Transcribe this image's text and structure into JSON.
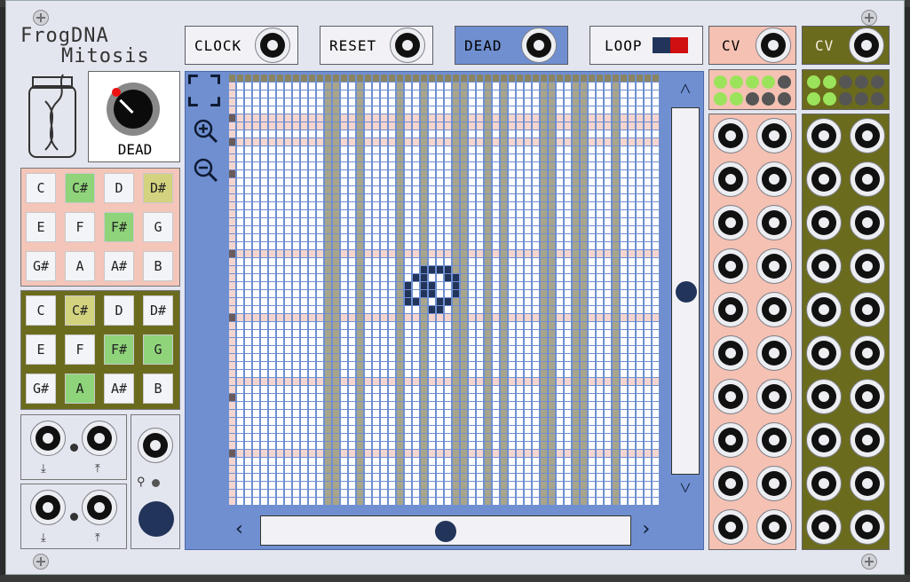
{
  "module": {
    "title_line1": "FrogDNA",
    "title_line2": "Mitosis",
    "knob_label": "DEAD"
  },
  "buttons": [
    {
      "id": "clock",
      "label": "CLOCK"
    },
    {
      "id": "reset",
      "label": "RESET"
    },
    {
      "id": "dead",
      "label": "DEAD"
    },
    {
      "id": "loop",
      "label": "LOOP"
    }
  ],
  "cv_labels": [
    "CV",
    "CV"
  ],
  "scale1": {
    "notes": [
      "C",
      "C#",
      "D",
      "D#",
      "E",
      "F",
      "F#",
      "G",
      "G#",
      "A",
      "A#",
      "B"
    ],
    "states": [
      "off",
      "on",
      "off",
      "dim",
      "off",
      "off",
      "on",
      "off",
      "off",
      "off",
      "off",
      "off"
    ]
  },
  "scale2": {
    "notes": [
      "C",
      "C#",
      "D",
      "D#",
      "E",
      "F",
      "F#",
      "G",
      "G#",
      "A",
      "A#",
      "B"
    ],
    "states": [
      "off",
      "dim",
      "off",
      "off",
      "off",
      "off",
      "on",
      "on",
      "off",
      "on",
      "off",
      "off"
    ]
  },
  "icons": {
    "fullscreen": "fullscreen-icon",
    "zoom_in": "zoom-in-icon",
    "zoom_out": "zoom-out-icon",
    "scroll_up": "chevron-up-icon",
    "scroll_down": "chevron-down-icon",
    "scroll_left": "chevron-left-icon",
    "scroll_right": "chevron-right-icon"
  },
  "colors": {
    "grid_panel": "#6f8fd0",
    "cells_pink": "#f6d5cf",
    "cells_olive": "#a9a58a",
    "live_cell": "#22345a",
    "cv1_bg": "#f4c1b3",
    "cv2_bg": "#6b6b1e",
    "led_green": "#9be35b",
    "led_off": "#555555"
  }
}
